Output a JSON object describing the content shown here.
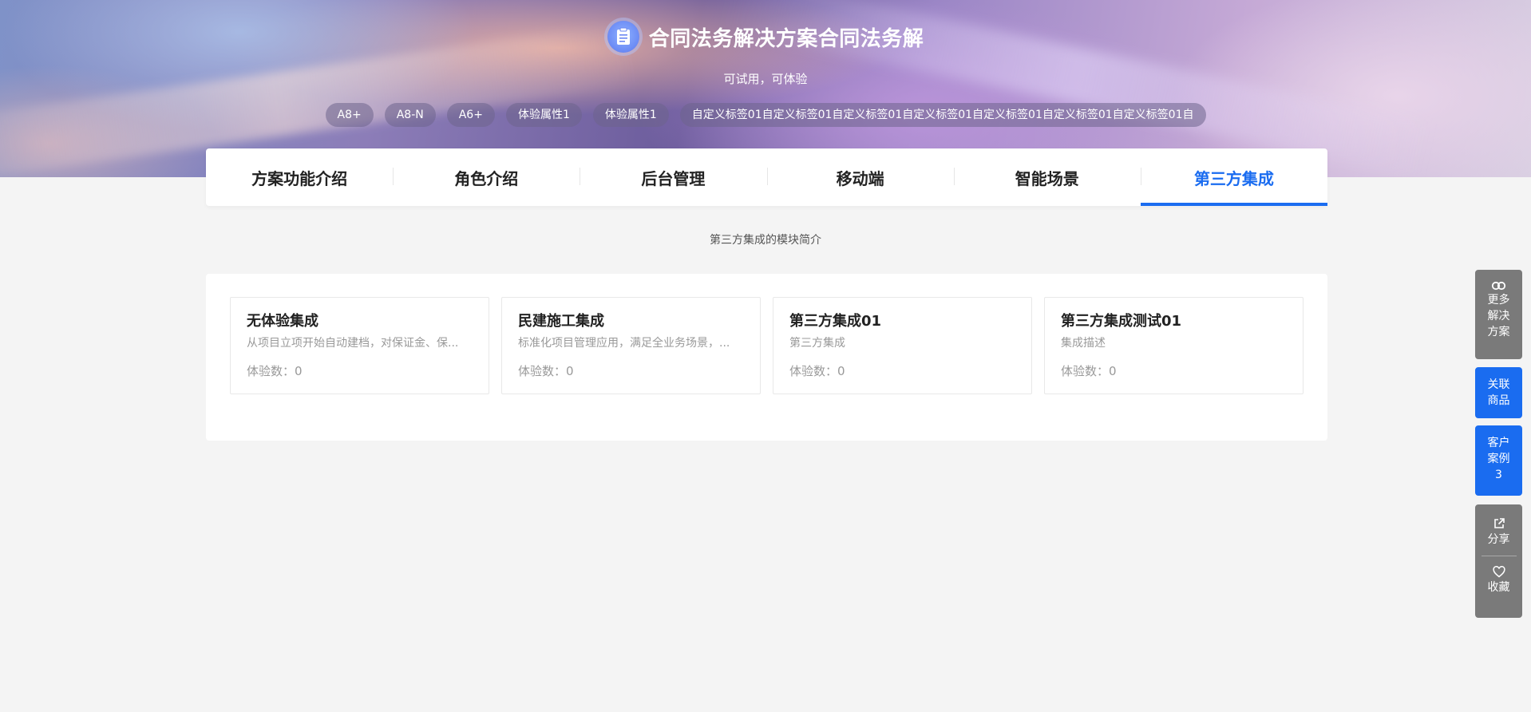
{
  "header": {
    "title": "合同法务解决方案合同法务解",
    "icon": "clipboard-icon",
    "subtitle": "可试用，可体验",
    "tags": [
      "A8+",
      "A8-N",
      "A6+",
      "体验属性1",
      "体验属性1",
      "自定义标签01自定义标签01自定义标签01自定义标签01自定义标签01自定义标签01自定义标签01自"
    ]
  },
  "tabs": [
    {
      "label": "方案功能介绍",
      "active": false
    },
    {
      "label": "角色介绍",
      "active": false
    },
    {
      "label": "后台管理",
      "active": false
    },
    {
      "label": "移动端",
      "active": false
    },
    {
      "label": "智能场景",
      "active": false
    },
    {
      "label": "第三方集成",
      "active": true
    }
  ],
  "section": {
    "intro": "第三方集成的模块简介"
  },
  "cards": [
    {
      "title": "无体验集成",
      "desc": "从项目立项开始自动建档，对保证金、保...",
      "count": "体验数：0"
    },
    {
      "title": "民建施工集成",
      "desc": "标准化项目管理应用，满足全业务场景，...",
      "count": "体验数：0"
    },
    {
      "title": "第三方集成01",
      "desc": "第三方集成",
      "count": "体验数：0"
    },
    {
      "title": "第三方集成测试01",
      "desc": "集成描述",
      "count": "体验数：0"
    }
  ],
  "floatbar": {
    "more": {
      "icon": "link-icon",
      "lines": [
        "更多",
        "解决",
        "方案"
      ]
    },
    "goods": {
      "lines": [
        "关联",
        "商品"
      ]
    },
    "cases": {
      "lines": [
        "客户",
        "案例",
        "3"
      ]
    },
    "share": {
      "icon": "share-icon",
      "label": "分享"
    },
    "favorite": {
      "icon": "heart-icon",
      "label": "收藏"
    }
  },
  "colors": {
    "accent": "#1a6cf0",
    "page_bg": "#f4f4f4",
    "float_gray": "#7a7a7a"
  }
}
